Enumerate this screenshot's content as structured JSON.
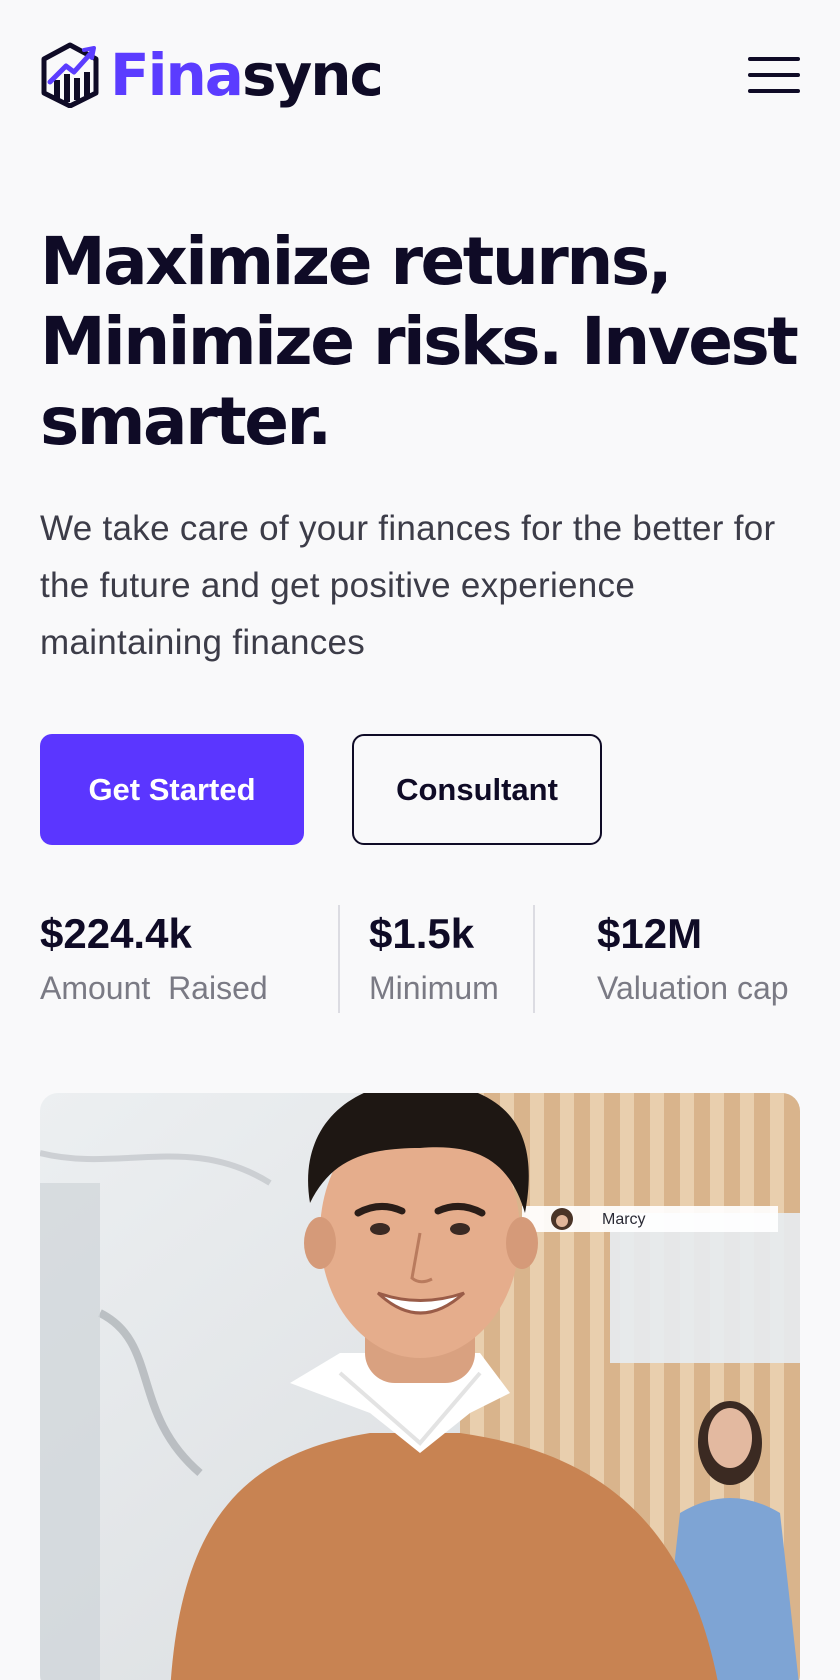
{
  "brand": {
    "name_part1": "Fina",
    "name_part2": "sync",
    "accent_color": "#5b3cff",
    "dark_color": "#0f0b26"
  },
  "header": {
    "menu_icon": "hamburger-menu-icon",
    "logo_icon": "bar-chart-cube-icon"
  },
  "hero": {
    "title": "Maximize returns, Minimize risks. Invest smarter.",
    "subtitle": "We take care of your finances for the better for the future and get positive experience maintaining finances"
  },
  "cta": {
    "primary_label": "Get Started",
    "secondary_label": "Consultant"
  },
  "stats": [
    {
      "value": "$224.4k",
      "label": "Amount  Raised"
    },
    {
      "value": "$1.5k",
      "label": "Minimum"
    },
    {
      "value": "$12M",
      "label": "Valuation cap"
    }
  ],
  "photo": {
    "chip_name": "Marcy"
  }
}
